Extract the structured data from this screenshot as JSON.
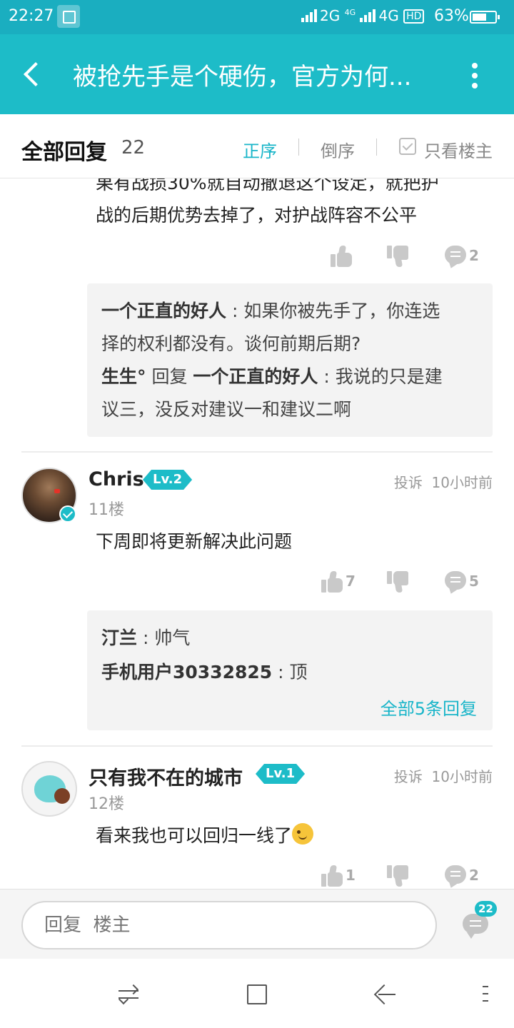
{
  "status_bar": {
    "time": "22:27",
    "network": "2G",
    "network_tag": "4G",
    "network2": "4G",
    "hd": "HD",
    "battery": "63%",
    "battery_level": 0.63
  },
  "app_bar": {
    "title": "被抢先手是个硬伤，官方为何..."
  },
  "reply_header": {
    "label": "全部回复",
    "count": "22",
    "sort_asc": "正序",
    "sort_desc": "倒序",
    "only_op": "只看楼主"
  },
  "posts": [
    {
      "text_lines": [
        "果有战损30%就自动撤退这个设定，就把护",
        "战的后期优势去掉了，对护战阵容不公平"
      ],
      "likes": "",
      "comments": "2",
      "replies": [
        {
          "author": "一个正直的好人",
          "sep": " : ",
          "text": "如果你被先手了，你连选"
        },
        {
          "author": "",
          "sep": "",
          "text": "择的权利都没有。谈何前期后期?"
        },
        {
          "author": "生生°",
          "reply_word": " 回复 ",
          "target": "一个正直的好人",
          "sep": " : ",
          "text": "我说的只是建"
        },
        {
          "author": "",
          "sep": "",
          "text": "议三，没反对建议一和建议二啊"
        }
      ]
    },
    {
      "username": "Chris",
      "level": "Lv.2",
      "floor": "11楼",
      "report": "投诉",
      "time": "10小时前",
      "text": "下周即将更新解决此问题",
      "likes": "7",
      "comments": "5",
      "replies": [
        {
          "author": "汀兰",
          "sep": " : ",
          "text": "帅气"
        },
        {
          "author": "手机用户30332825",
          "sep": " : ",
          "text": "顶"
        }
      ],
      "see_all": "全部5条回复"
    },
    {
      "username": "只有我不在的城市",
      "level": "Lv.1",
      "floor": "12楼",
      "report": "投诉",
      "time": "10小时前",
      "text": "看来我也可以回归一线了",
      "likes": "1",
      "comments": "2"
    }
  ],
  "reply_bar": {
    "placeholder": "回复  楼主",
    "badge": "22"
  },
  "icons": {
    "back": "back-arrow-icon",
    "more": "more-vertical-icon",
    "like": "thumbs-up-icon",
    "dislike": "thumbs-down-icon",
    "comment": "comment-bubble-icon"
  },
  "colors": {
    "accent": "#1dbcc8",
    "status_bar": "#1aaec0",
    "link": "#19b5c9"
  }
}
